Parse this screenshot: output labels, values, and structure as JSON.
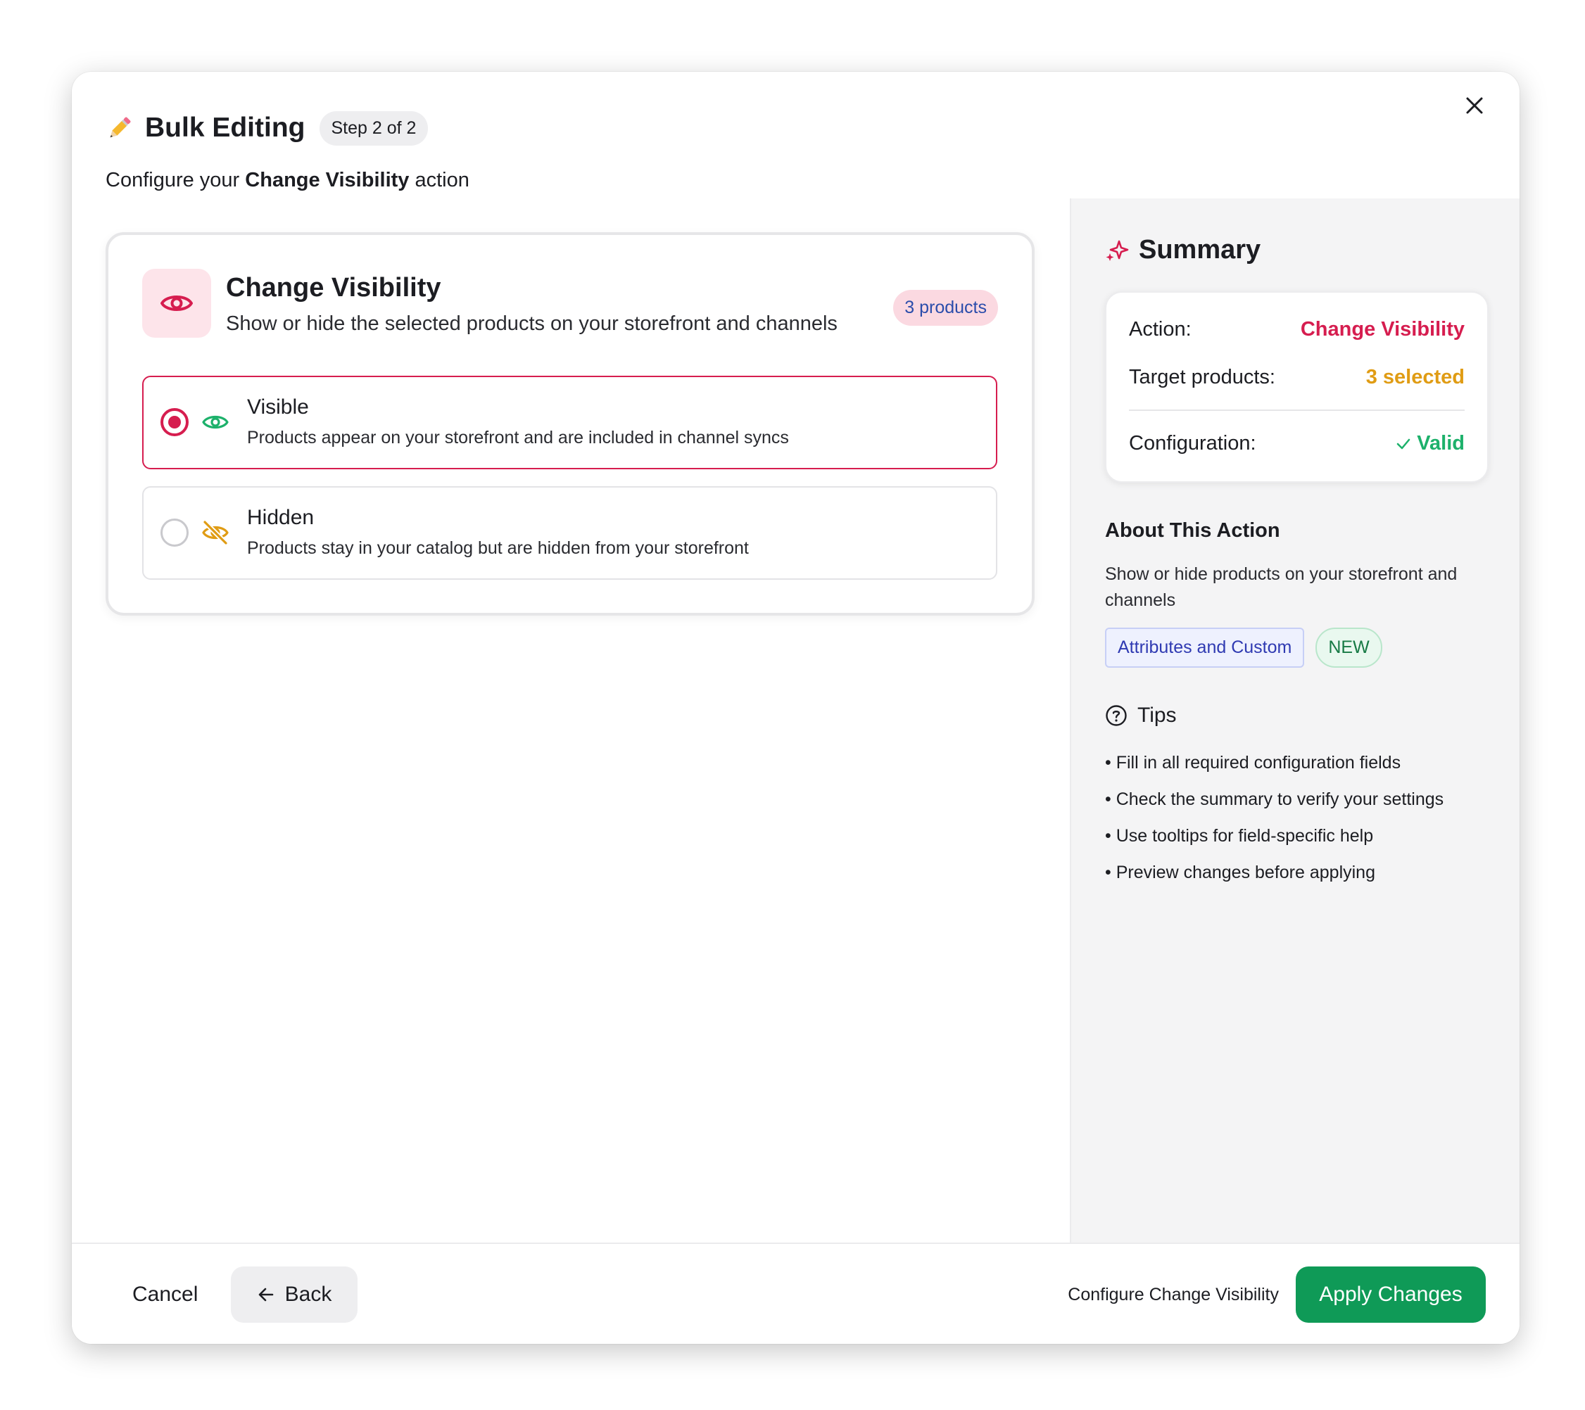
{
  "header": {
    "title": "Bulk Editing",
    "step_badge": "Step 2 of 2",
    "subtitle_prefix": "Configure your ",
    "subtitle_action": "Change Visibility",
    "subtitle_suffix": " action",
    "close_icon": "close-icon"
  },
  "card": {
    "icon": "eye-icon",
    "title": "Change Visibility",
    "description": "Show or hide the selected products on your storefront and channels",
    "badge": "3 products",
    "options": [
      {
        "title": "Visible",
        "description": "Products appear on your storefront and are included in channel syncs",
        "selected": true,
        "icon": "eye-icon"
      },
      {
        "title": "Hidden",
        "description": "Products stay in your catalog but are hidden from your storefront",
        "selected": false,
        "icon": "eye-off-icon"
      }
    ]
  },
  "summary": {
    "title": "Summary",
    "rows": [
      {
        "label": "Action:",
        "value": "Change Visibility"
      },
      {
        "label": "Target products:",
        "value": "3 selected"
      },
      {
        "label": "Configuration:",
        "value": "Valid"
      }
    ]
  },
  "about": {
    "title": "About This Action",
    "description": "Show or hide products on your storefront and channels",
    "tags": [
      "Attributes and Custom",
      "NEW"
    ]
  },
  "tips": {
    "title": "Tips",
    "items": [
      "Fill in all required configuration fields",
      "Check the summary to verify your settings",
      "Use tooltips for field-specific help",
      "Preview changes before applying"
    ]
  },
  "footer": {
    "cancel": "Cancel",
    "back": "Back",
    "hint": "Configure Change Visibility",
    "apply": "Apply Changes"
  },
  "colors": {
    "accent": "#d61d4f",
    "success": "#0f9a57",
    "warning": "#e09c14",
    "valid": "#1db16b"
  }
}
